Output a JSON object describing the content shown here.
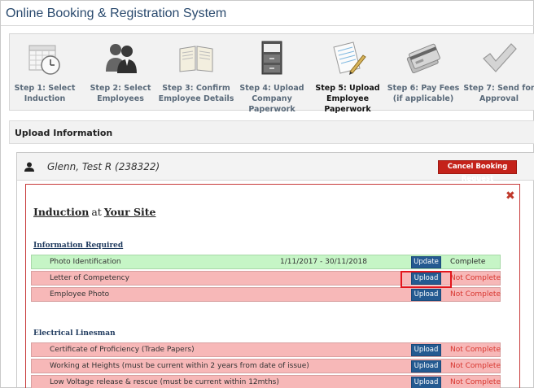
{
  "app": {
    "title": "Online Booking & Registration System"
  },
  "steps": [
    {
      "line1": "Step 1: Select",
      "line2": "Induction",
      "icon": "calendar-clock-icon",
      "active": false
    },
    {
      "line1": "Step 2: Select",
      "line2": "Employees",
      "icon": "people-icon",
      "active": false
    },
    {
      "line1": "Step 3: Confirm",
      "line2": "Employee Details",
      "icon": "open-book-icon",
      "active": false
    },
    {
      "line1": "Step 4: Upload",
      "line2": "Company Paperwork",
      "icon": "filing-cabinet-icon",
      "active": false
    },
    {
      "line1": "Step 5: Upload",
      "line2": "Employee Paperwork",
      "icon": "document-pen-icon",
      "active": true
    },
    {
      "line1": "Step 6: Pay Fees",
      "line2": "(if applicable)",
      "icon": "credit-card-icon",
      "active": false
    },
    {
      "line1": "Step 7: Send for",
      "line2": "Approval",
      "icon": "checkmark-icon",
      "active": false
    }
  ],
  "upload_section": {
    "title": "Upload Information"
  },
  "employee": {
    "name": "Glenn, Test R (238322)",
    "cancel_label": "Cancel Booking Request"
  },
  "induction": {
    "link": "Induction",
    "at": "at",
    "site": "Your Site",
    "close": "✖"
  },
  "sections": [
    {
      "title": "Information Required",
      "rows": [
        {
          "name": "Photo Identification",
          "dates": "1/11/2017 - 30/11/2018",
          "button": "Update",
          "status": "Complete",
          "ok": true
        },
        {
          "name": "Letter of Competency",
          "dates": "",
          "button": "Upload",
          "status": "Not Complete",
          "ok": false
        },
        {
          "name": "Employee Photo",
          "dates": "",
          "button": "Upload",
          "status": "Not Complete",
          "ok": false
        }
      ]
    },
    {
      "title": "Electrical Linesman",
      "rows": [
        {
          "name": "Certificate of Proficiency (Trade Papers)",
          "dates": "",
          "button": "Upload",
          "status": "Not Complete",
          "ok": false
        },
        {
          "name": "Working at Heights (must be current within 2 years from date of issue)",
          "dates": "",
          "button": "Upload",
          "status": "Not Complete",
          "ok": false
        },
        {
          "name": "Low Voltage release & rescue (must be current within 12mths)",
          "dates": "",
          "button": "Upload",
          "status": "Not Complete",
          "ok": false
        }
      ]
    }
  ],
  "colors": {
    "accent": "#245a91",
    "danger": "#c4221a",
    "ok_row": "#c6f5c6",
    "bad_row": "#f7b8b8"
  }
}
